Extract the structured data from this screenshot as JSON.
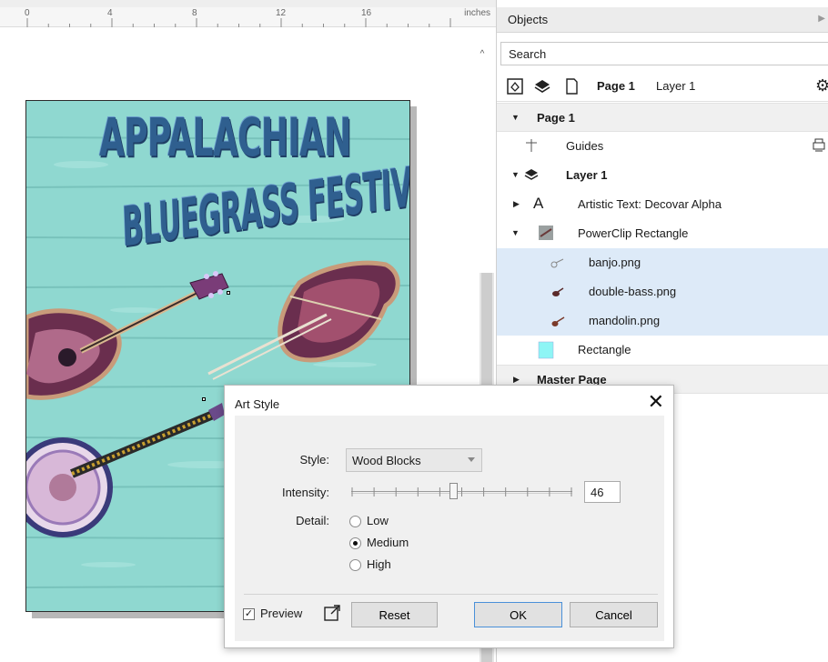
{
  "ruler": {
    "ticks": [
      "0",
      "4",
      "8",
      "12",
      "16"
    ],
    "unit": "inches"
  },
  "artwork": {
    "title_line1": "APPALACHIAN",
    "title_line2": "BLUEGRASS FESTIVAL"
  },
  "objects_panel": {
    "title": "Objects",
    "search_placeholder": "Search",
    "toolbar": {
      "page": "Page 1",
      "layer": "Layer 1"
    },
    "tree": {
      "page": "Page 1",
      "guides": "Guides",
      "layer": "Layer 1",
      "artistic_text": "Artistic Text: Decovar Alpha",
      "powerclip": "PowerClip Rectangle",
      "children": [
        "banjo.png",
        "double-bass.png",
        "mandolin.png"
      ],
      "rectangle": "Rectangle",
      "master_page": "Master Page"
    }
  },
  "dialog": {
    "title": "Art Style",
    "close": "✕",
    "style_label": "Style:",
    "style_value": "Wood Blocks",
    "intensity_label": "Intensity:",
    "intensity_value": "46",
    "intensity_fraction": 0.46,
    "detail_label": "Detail:",
    "detail_options": [
      "Low",
      "Medium",
      "High"
    ],
    "detail_selected": "Medium",
    "preview_label": "Preview",
    "preview_checked": true,
    "reset_button": "Reset",
    "ok_button": "OK",
    "cancel_button": "Cancel"
  },
  "colors": {
    "canvas_plank": "#8fd8d0",
    "title_blue": "#2f5f8f",
    "selection": "#ddeaf8",
    "rectangle_swatch": "#8ef5f5"
  }
}
